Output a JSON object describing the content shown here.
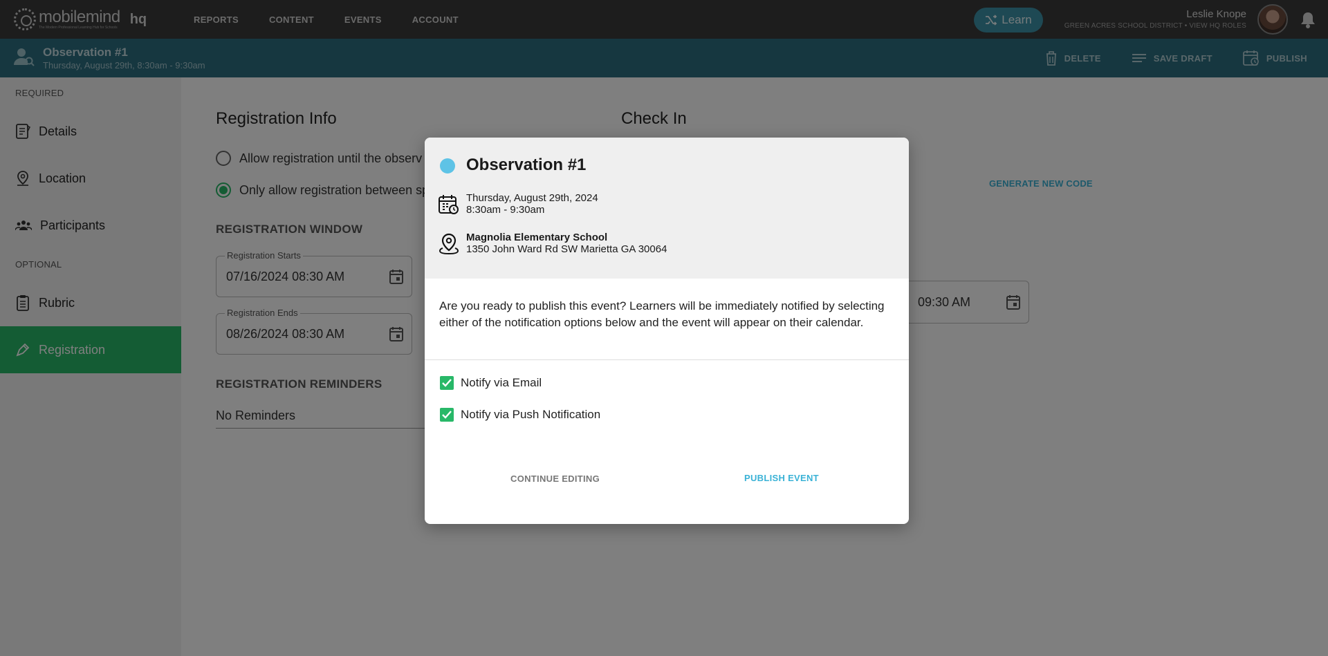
{
  "topbar": {
    "logo_name": "mobilemind",
    "logo_tagline": "The Modern Professional Learning Hub for Schools",
    "logo_hq": "hq",
    "nav": [
      "REPORTS",
      "CONTENT",
      "EVENTS",
      "ACCOUNT"
    ],
    "learn_label": "Learn",
    "user_name": "Leslie Knope",
    "user_sub": "GREEN ACRES SCHOOL DISTRICT • VIEW HQ ROLES"
  },
  "subheader": {
    "title": "Observation #1",
    "date": "Thursday, August 29th, 8:30am - 9:30am",
    "actions": {
      "delete": "DELETE",
      "save_draft": "SAVE DRAFT",
      "publish": "PUBLISH"
    }
  },
  "sidebar": {
    "required_label": "REQUIRED",
    "optional_label": "OPTIONAL",
    "items": [
      "Details",
      "Location",
      "Participants",
      "Rubric",
      "Registration"
    ]
  },
  "main": {
    "registration_heading": "Registration Info",
    "checkin_heading": "Check In",
    "radio_1": "Allow registration until the observ",
    "radio_2": "Only allow registration between sp",
    "window_label": "REGISTRATION WINDOW",
    "starts_label": "Registration Starts",
    "starts_value": "07/16/2024 08:30 AM",
    "ends_label": "Registration Ends",
    "ends_value": "08/26/2024 08:30 AM",
    "reminders_label": "REGISTRATION REMINDERS",
    "reminders_value": "No Reminders",
    "generate_code": "GENERATE NEW CODE",
    "right_field_value": "09:30 AM"
  },
  "modal": {
    "title": "Observation #1",
    "dot_color": "#5ec3e6",
    "date_line1": "Thursday, August 29th, 2024",
    "date_line2": "8:30am - 9:30am",
    "location_name": "Magnolia Elementary School",
    "location_address": "1350 John Ward Rd SW Marietta GA 30064",
    "message": "Are you ready to publish this event? Learners will be immediately notified by selecting either of the notification options below and the event will appear on their calendar.",
    "notify_email": "Notify via Email",
    "notify_push": "Notify via Push Notification",
    "continue_label": "CONTINUE EDITING",
    "publish_label": "PUBLISH EVENT"
  },
  "colors": {
    "accent_green": "#28b868",
    "accent_blue": "#3ab2d6",
    "header_teal": "#2c6f80"
  }
}
